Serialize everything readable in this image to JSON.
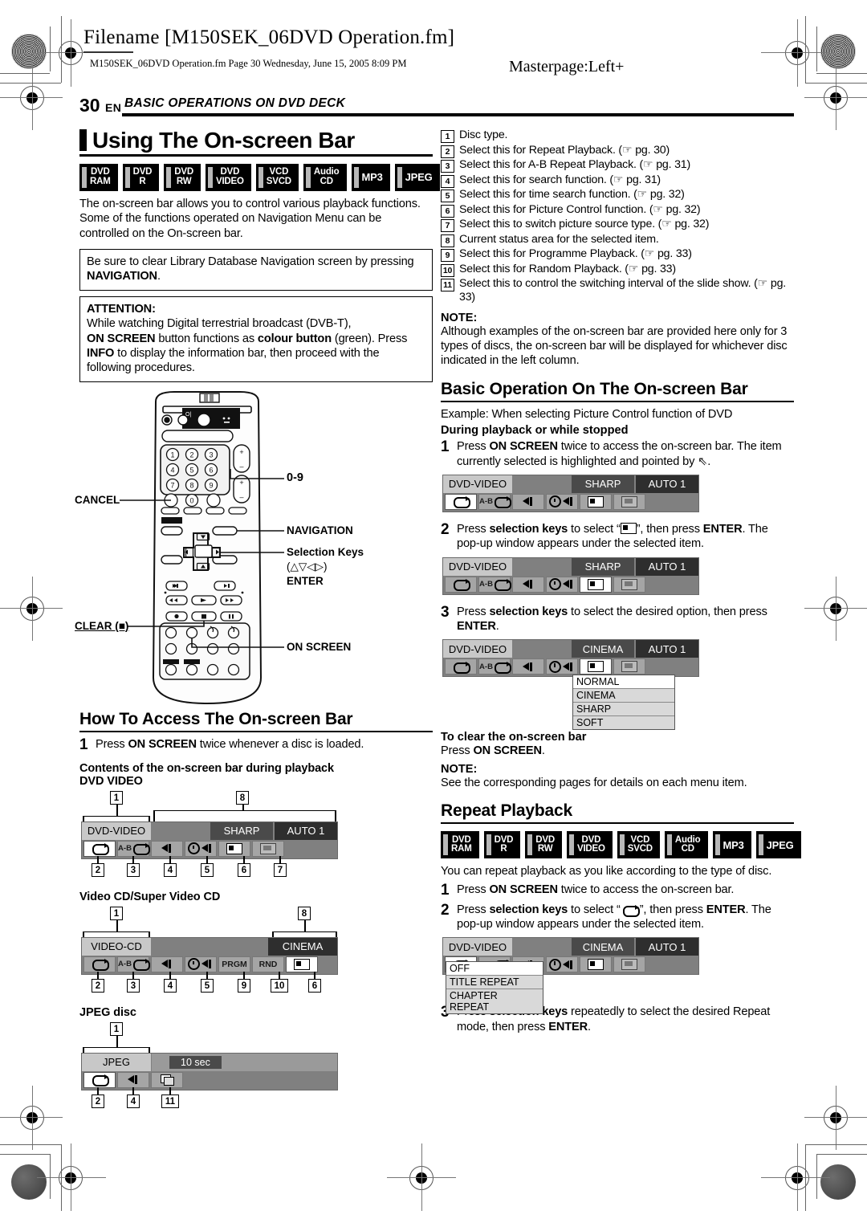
{
  "header": {
    "filename": "Filename [M150SEK_06DVD Operation.fm]",
    "filepath": "M150SEK_06DVD Operation.fm  Page 30  Wednesday, June 15, 2005  8:09 PM",
    "masterpage": "Masterpage:Left+",
    "page_number": "30",
    "page_lang": "EN",
    "chapter_title": "BASIC OPERATIONS ON DVD DECK"
  },
  "left": {
    "section_title": "Using The On-screen Bar",
    "badges": [
      {
        "line1": "DVD",
        "line2": "RAM"
      },
      {
        "line1": "DVD",
        "line2": "R"
      },
      {
        "line1": "DVD",
        "line2": "RW"
      },
      {
        "line1": "DVD",
        "line2": "VIDEO"
      },
      {
        "line1": "VCD",
        "line2": "SVCD"
      },
      {
        "line1": "Audio",
        "line2": "CD"
      },
      {
        "line1": "MP3",
        "line2": ""
      },
      {
        "line1": "JPEG",
        "line2": ""
      }
    ],
    "intro": "The on-screen bar allows you to control various playback functions. Some of the functions operated on Navigation Menu can be controlled on the On-screen bar.",
    "note_box": {
      "text_before": "Be sure to clear Library Database Navigation screen by pressing ",
      "bold_term": "NAVIGATION",
      "text_after": "."
    },
    "attention_box": {
      "title": "ATTENTION:",
      "line1": "While watching Digital terrestrial broadcast (DVB-T),",
      "line2_a": "ON SCREEN",
      "line2_b": " button functions as ",
      "line2_c": "colour button",
      "line2_d": " (green). Press",
      "line3_a": "INFO",
      "line3_b": " to display the information bar, then proceed with the",
      "line4": "following procedures."
    },
    "remote_labels": {
      "zero_nine": "0-9",
      "cancel": "CANCEL",
      "navigation": "NAVIGATION",
      "selection_keys": "Selection Keys",
      "selection_arrows": "(△▽◁▷)",
      "enter": "ENTER",
      "clear": "CLEAR (■)",
      "on_screen": "ON SCREEN"
    },
    "access_title": "How To Access The On-screen Bar",
    "access_step1": {
      "num": "1",
      "text_a": "Press ",
      "bold": "ON SCREEN",
      "text_b": " twice whenever a disc is loaded."
    },
    "contents_title": "Contents of the on-screen bar during playback",
    "dvd_video_label": "DVD VIDEO",
    "video_cd_label": "Video CD/Super Video CD",
    "jpeg_label": "JPEG disc",
    "bar_dvd_video": {
      "disc": "DVD-VIDEO",
      "status1": "SHARP",
      "status2": "AUTO 1",
      "callouts_top": [
        "1",
        "8"
      ],
      "callouts_bottom": [
        "2",
        "3",
        "4",
        "5",
        "6",
        "7"
      ]
    },
    "bar_video_cd": {
      "disc": "VIDEO-CD",
      "status1": "CINEMA",
      "prgm": "PRGM",
      "rnd": "RND",
      "callouts_top": [
        "1",
        "8"
      ],
      "callouts_bottom": [
        "2",
        "3",
        "4",
        "5",
        "9",
        "10",
        "6"
      ]
    },
    "bar_jpeg": {
      "disc": "JPEG",
      "interval": "10 sec",
      "callouts_top": [
        "1"
      ],
      "callouts_bottom": [
        "2",
        "4",
        "11"
      ]
    }
  },
  "right": {
    "legend": [
      {
        "n": "1",
        "text": "Disc type."
      },
      {
        "n": "2",
        "text": "Select this for Repeat Playback. (☞ pg. 30)"
      },
      {
        "n": "3",
        "text": "Select this for A-B Repeat Playback. (☞ pg. 31)"
      },
      {
        "n": "4",
        "text": "Select this for search function. (☞ pg. 31)"
      },
      {
        "n": "5",
        "text": "Select this for time search function. (☞ pg. 32)"
      },
      {
        "n": "6",
        "text": "Select this for Picture Control function. (☞ pg. 32)"
      },
      {
        "n": "7",
        "text": "Select this to switch picture source type. (☞ pg. 32)"
      },
      {
        "n": "8",
        "text": "Current status area for the selected item."
      },
      {
        "n": "9",
        "text": "Select this for Programme Playback. (☞ pg. 33)"
      },
      {
        "n": "10",
        "text": "Select this for Random Playback. (☞ pg. 33)"
      },
      {
        "n": "11",
        "text": "Select this to control the switching interval of the slide show. (☞ pg. 33)"
      }
    ],
    "note1": {
      "title": "NOTE:",
      "text": "Although examples of the on-screen bar are provided here only for 3 types of discs, the on-screen bar will be displayed for whichever disc indicated in the left column."
    },
    "basic_title": "Basic Operation On The On-screen Bar",
    "example_line": "Example: When selecting Picture Control function of DVD",
    "during_line": "During playback or while stopped",
    "step1": {
      "num": "1",
      "a": "Press ",
      "bold1": "ON SCREEN",
      "b": " twice to access the on-screen bar. The item currently selected is highlighted and pointed by ",
      "cursor": "⇖",
      "c": "."
    },
    "step2": {
      "num": "2",
      "a": "Press ",
      "bold1": "selection keys",
      "b": " to select “",
      "icon": "picture-control-icon",
      "c": "”, then press ",
      "bold2": "ENTER",
      "d": ". The pop-up window appears under the selected item."
    },
    "step3": {
      "num": "3",
      "a": "Press ",
      "bold1": "selection keys",
      "b": " to select the desired option, then press ",
      "bold2": "ENTER",
      "c": "."
    },
    "bar_step1": {
      "disc": "DVD-VIDEO",
      "status1": "SHARP",
      "status2": "AUTO 1"
    },
    "bar_step2": {
      "disc": "DVD-VIDEO",
      "status1": "SHARP",
      "status2": "AUTO 1"
    },
    "bar_step3": {
      "disc": "DVD-VIDEO",
      "status1": "CINEMA",
      "status2": "AUTO 1"
    },
    "picture_popup": [
      "NORMAL",
      "CINEMA",
      "SHARP",
      "SOFT"
    ],
    "clear_title": "To clear the on-screen bar",
    "clear_text_a": "Press ",
    "clear_bold": "ON SCREEN",
    "clear_text_b": ".",
    "note2": {
      "title": "NOTE:",
      "text": "See the corresponding pages for details on each menu item."
    },
    "repeat_title": "Repeat Playback",
    "repeat_badges": [
      {
        "line1": "DVD",
        "line2": "RAM"
      },
      {
        "line1": "DVD",
        "line2": "R"
      },
      {
        "line1": "DVD",
        "line2": "RW"
      },
      {
        "line1": "DVD",
        "line2": "VIDEO"
      },
      {
        "line1": "VCD",
        "line2": "SVCD"
      },
      {
        "line1": "Audio",
        "line2": "CD"
      },
      {
        "line1": "MP3",
        "line2": ""
      },
      {
        "line1": "JPEG",
        "line2": ""
      }
    ],
    "repeat_intro": "You can repeat playback as you like according to the type of disc.",
    "repeat_step1": {
      "num": "1",
      "a": "Press ",
      "bold1": "ON SCREEN",
      "b": " twice to access the on-screen bar."
    },
    "repeat_step2": {
      "num": "2",
      "a": "Press ",
      "bold1": "selection keys",
      "b": " to select “",
      "icon": "repeat-loop-icon",
      "c": "”, then press ",
      "bold2": "ENTER",
      "d": ". The pop-up window appears under the selected item."
    },
    "repeat_step3": {
      "num": "3",
      "a": "Press ",
      "bold1": "selection keys",
      "b": " repeatedly to select the desired Repeat mode, then press ",
      "bold2": "ENTER",
      "c": "."
    },
    "bar_repeat": {
      "disc": "DVD-VIDEO",
      "status1": "CINEMA",
      "status2": "AUTO 1"
    },
    "repeat_popup": [
      "OFF",
      "TITLE REPEAT",
      "CHAPTER REPEAT"
    ]
  }
}
